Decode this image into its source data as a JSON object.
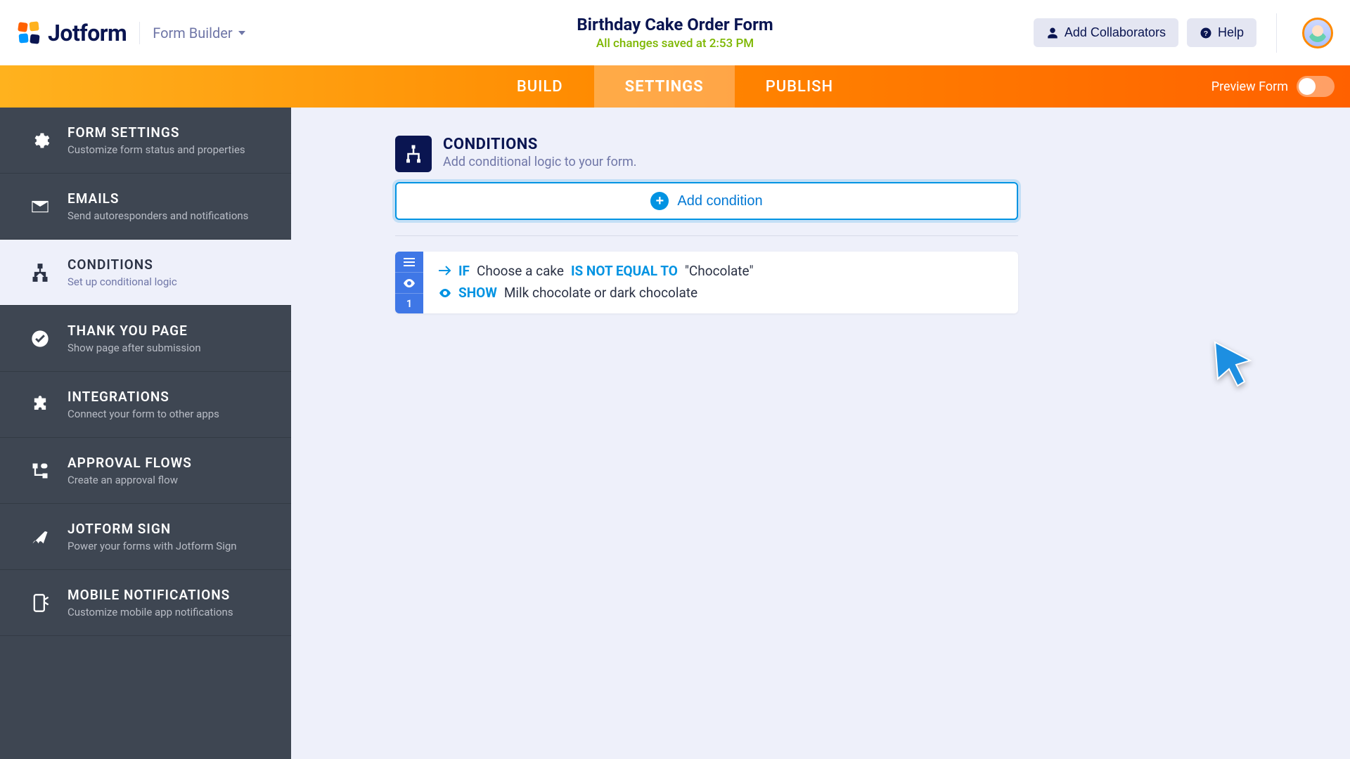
{
  "header": {
    "logo_text": "Jotform",
    "form_builder_label": "Form Builder",
    "form_title": "Birthday Cake Order Form",
    "save_status": "All changes saved at 2:53 PM",
    "add_collaborators": "Add Collaborators",
    "help": "Help"
  },
  "tabs": {
    "build": "BUILD",
    "settings": "SETTINGS",
    "publish": "PUBLISH",
    "preview_label": "Preview Form"
  },
  "sidebar": {
    "items": [
      {
        "title": "FORM SETTINGS",
        "sub": "Customize form status and properties",
        "icon": "gear"
      },
      {
        "title": "EMAILS",
        "sub": "Send autoresponders and notifications",
        "icon": "mail"
      },
      {
        "title": "CONDITIONS",
        "sub": "Set up conditional logic",
        "icon": "tree",
        "active": true
      },
      {
        "title": "THANK YOU PAGE",
        "sub": "Show page after submission",
        "icon": "check"
      },
      {
        "title": "INTEGRATIONS",
        "sub": "Connect your form to other apps",
        "icon": "puzzle"
      },
      {
        "title": "APPROVAL FLOWS",
        "sub": "Create an approval flow",
        "icon": "flow"
      },
      {
        "title": "JOTFORM SIGN",
        "sub": "Power your forms with Jotform Sign",
        "icon": "sign"
      },
      {
        "title": "MOBILE NOTIFICATIONS",
        "sub": "Customize mobile app notifications",
        "icon": "mobile"
      }
    ]
  },
  "page": {
    "title": "CONDITIONS",
    "subtitle": "Add conditional logic to your form.",
    "add_button": "Add condition"
  },
  "condition": {
    "index": "1",
    "if": "IF",
    "if_field": "Choose a cake",
    "operator": "IS NOT EQUAL TO",
    "value": "\"Chocolate\"",
    "show": "SHOW",
    "show_field": "Milk chocolate or dark chocolate"
  }
}
